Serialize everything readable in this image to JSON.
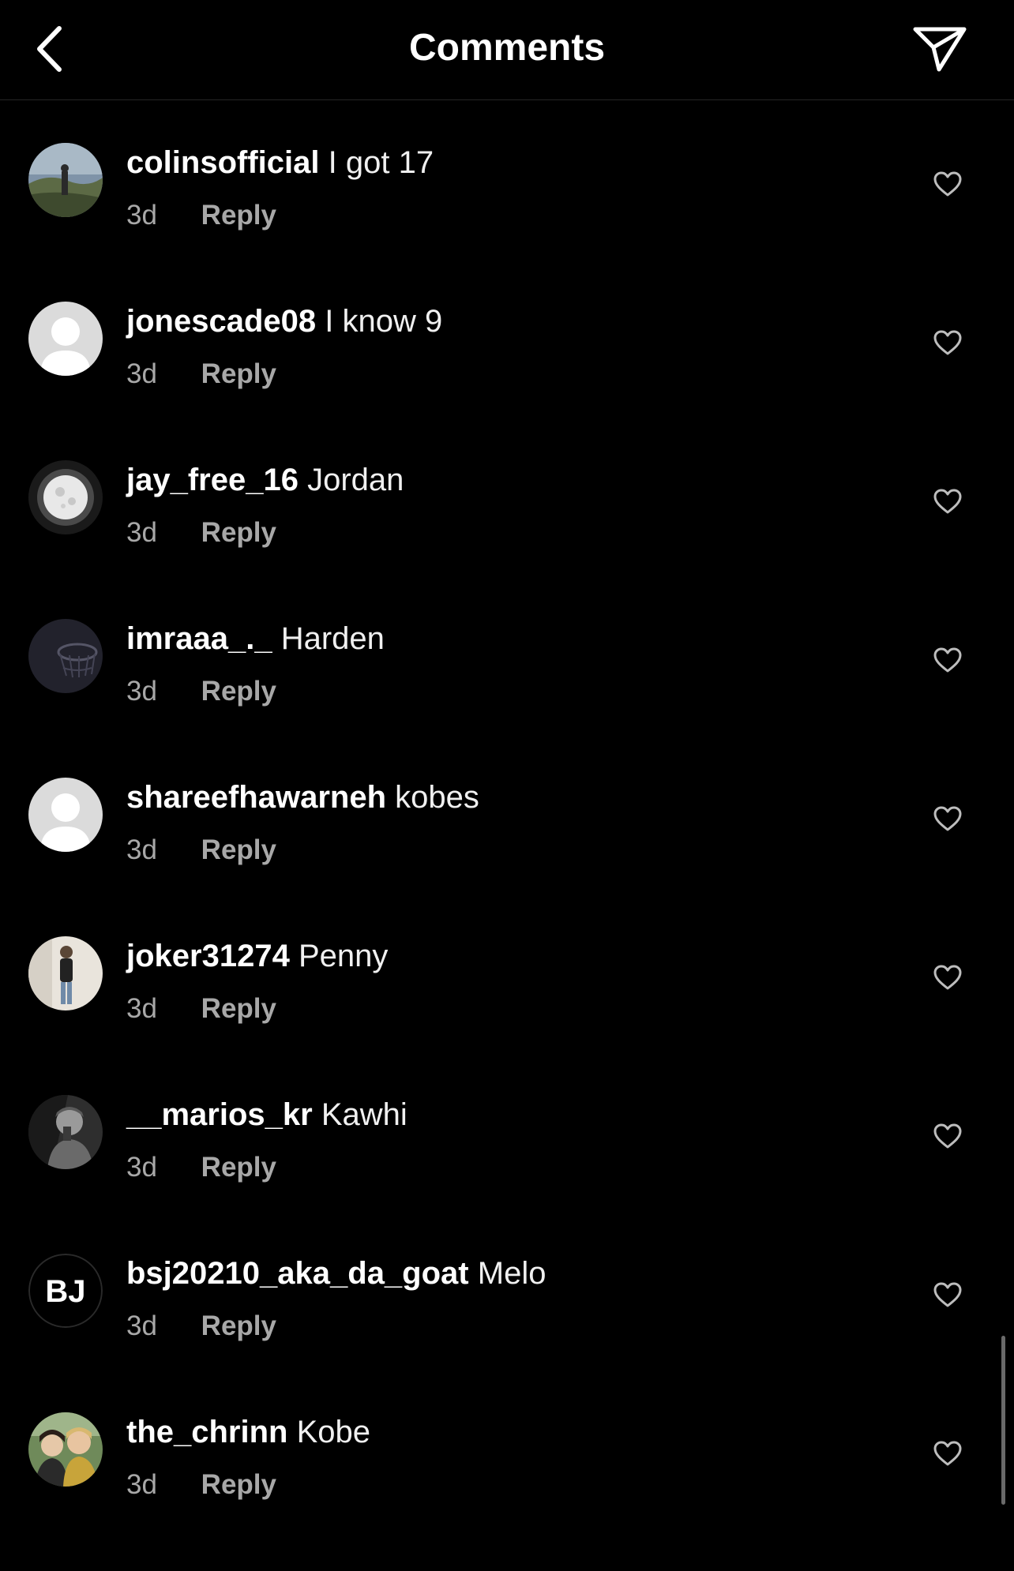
{
  "header": {
    "title": "Comments",
    "back_icon": "chevron-left-icon",
    "share_icon": "paper-plane-icon"
  },
  "comments": [
    {
      "username": "colinsofficial",
      "text": "I got 17",
      "time": "3d",
      "reply_label": "Reply",
      "avatar": "photo-person-landscape"
    },
    {
      "username": "jonescade08",
      "text": "I know 9",
      "time": "3d",
      "reply_label": "Reply",
      "avatar": "default-avatar"
    },
    {
      "username": "jay_free_16",
      "text": "Jordan",
      "time": "3d",
      "reply_label": "Reply",
      "avatar": "photo-moon"
    },
    {
      "username": "imraaa_._",
      "text": "Harden",
      "time": "3d",
      "reply_label": "Reply",
      "avatar": "photo-basketball-hoop"
    },
    {
      "username": "shareefhawarneh",
      "text": "kobes",
      "time": "3d",
      "reply_label": "Reply",
      "avatar": "default-avatar"
    },
    {
      "username": "joker31274",
      "text": "Penny",
      "time": "3d",
      "reply_label": "Reply",
      "avatar": "photo-person-standing"
    },
    {
      "username": "__marios_kr",
      "text": "Kawhi",
      "time": "3d",
      "reply_label": "Reply",
      "avatar": "photo-person-bw"
    },
    {
      "username": "bsj20210_aka_da_goat",
      "text": "Melo",
      "time": "3d",
      "reply_label": "Reply",
      "avatar": "logo-bj"
    },
    {
      "username": "the_chrinn",
      "text": "Kobe",
      "time": "3d",
      "reply_label": "Reply",
      "avatar": "photo-two-people"
    }
  ],
  "avatar_logo_text": "BJ",
  "colors": {
    "background": "#000000",
    "text": "#ffffff",
    "secondary_text": "#a8a8a8",
    "divider": "#262626"
  }
}
